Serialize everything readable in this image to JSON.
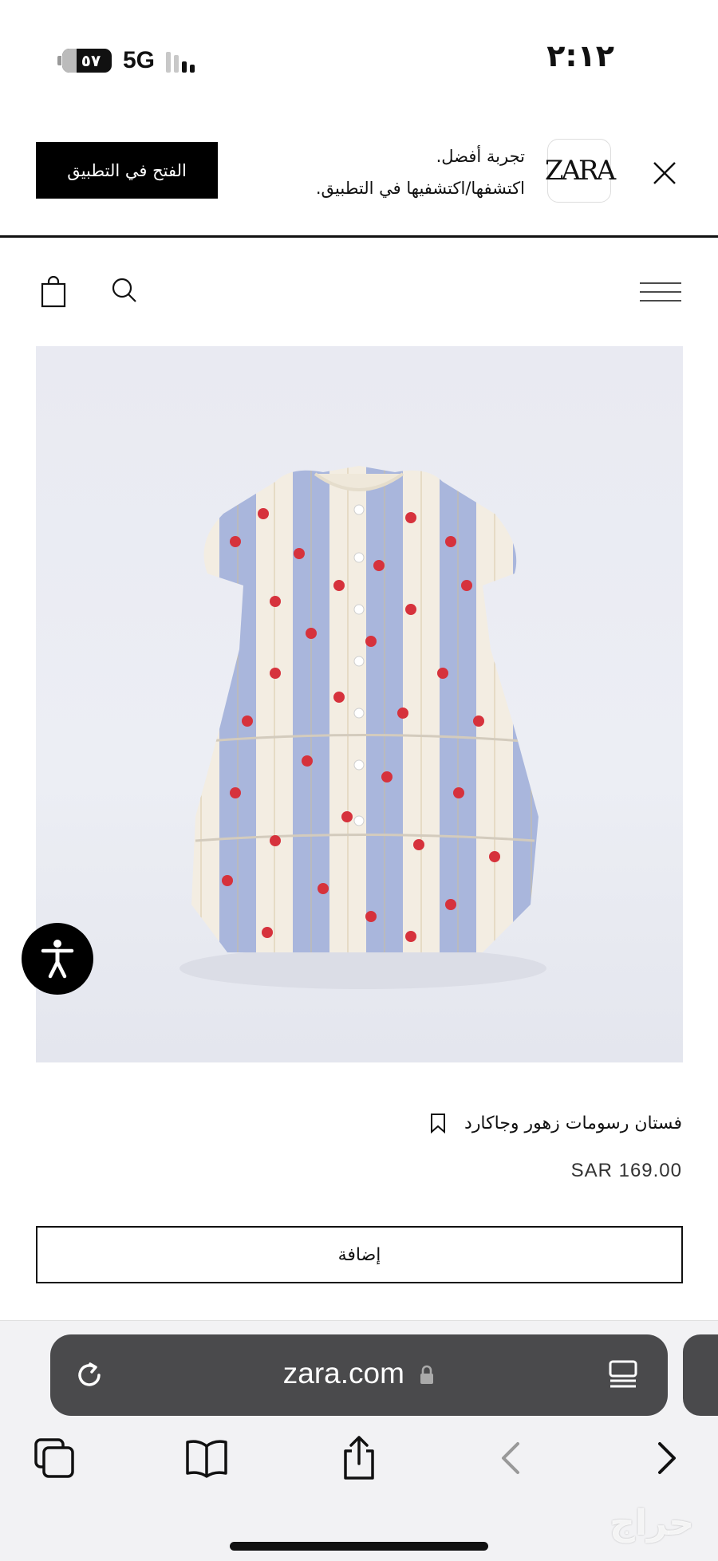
{
  "status_bar": {
    "time": "٢:١٢",
    "battery": "٥٧",
    "network": "5G"
  },
  "app_banner": {
    "headline": "تجربة أفضل.",
    "subline": "اكتشفها/اكتشفيها في التطبيق.",
    "open_button": "الفتح في التطبيق",
    "logo": "ZARA"
  },
  "product": {
    "name": "فستان رسومات زهور وجاكارد",
    "price": "SAR 169.00",
    "add_button": "إضافة"
  },
  "browser": {
    "url": "zara.com"
  },
  "watermark": "حراج",
  "colors": {
    "banner_button": "#000000",
    "address_bar": "#4a4a4c",
    "dress_stripe_blue": "#9fb0d8",
    "dress_flower_red": "#d6323c"
  }
}
